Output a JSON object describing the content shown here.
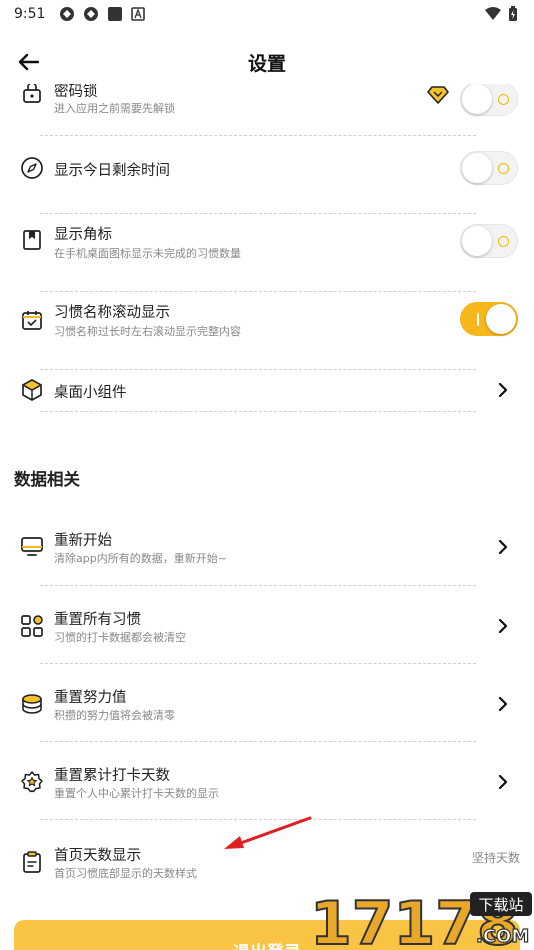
{
  "status_bar": {
    "time": "9:51"
  },
  "header": {
    "title": "设置"
  },
  "rows_top": [
    {
      "title": "密码锁",
      "subtitle": "进入应用之前需要先解锁",
      "toggle": false
    },
    {
      "title": "显示今日剩余时间",
      "subtitle": "",
      "toggle": false
    },
    {
      "title": "显示角标",
      "subtitle": "在手机桌面图标显示未完成的习惯数量",
      "toggle": false
    },
    {
      "title": "习惯名称滚动显示",
      "subtitle": "习惯名称过长时左右滚动显示完整内容",
      "toggle": true
    },
    {
      "title": "桌面小组件",
      "subtitle": ""
    }
  ],
  "section": {
    "title": "数据相关"
  },
  "rows_data": [
    {
      "title": "重新开始",
      "subtitle": "清除app内所有的数据，重新开始~"
    },
    {
      "title": "重置所有习惯",
      "subtitle": "习惯的打卡数据都会被清空"
    },
    {
      "title": "重置努力值",
      "subtitle": "积攒的努力值将会被清零"
    },
    {
      "title": "重置累计打卡天数",
      "subtitle": "重置个人中心累计打卡天数的显示"
    },
    {
      "title": "首页天数显示",
      "subtitle": "首页习惯底部显示的天数样式",
      "value": "坚持天数"
    }
  ],
  "logout": {
    "label": "退出登录"
  },
  "watermark": {
    "number": "17178",
    "badge": "下载站",
    "domain": ".COM"
  },
  "colors": {
    "accent": "#f7b71c",
    "arrow": "#e02020"
  }
}
